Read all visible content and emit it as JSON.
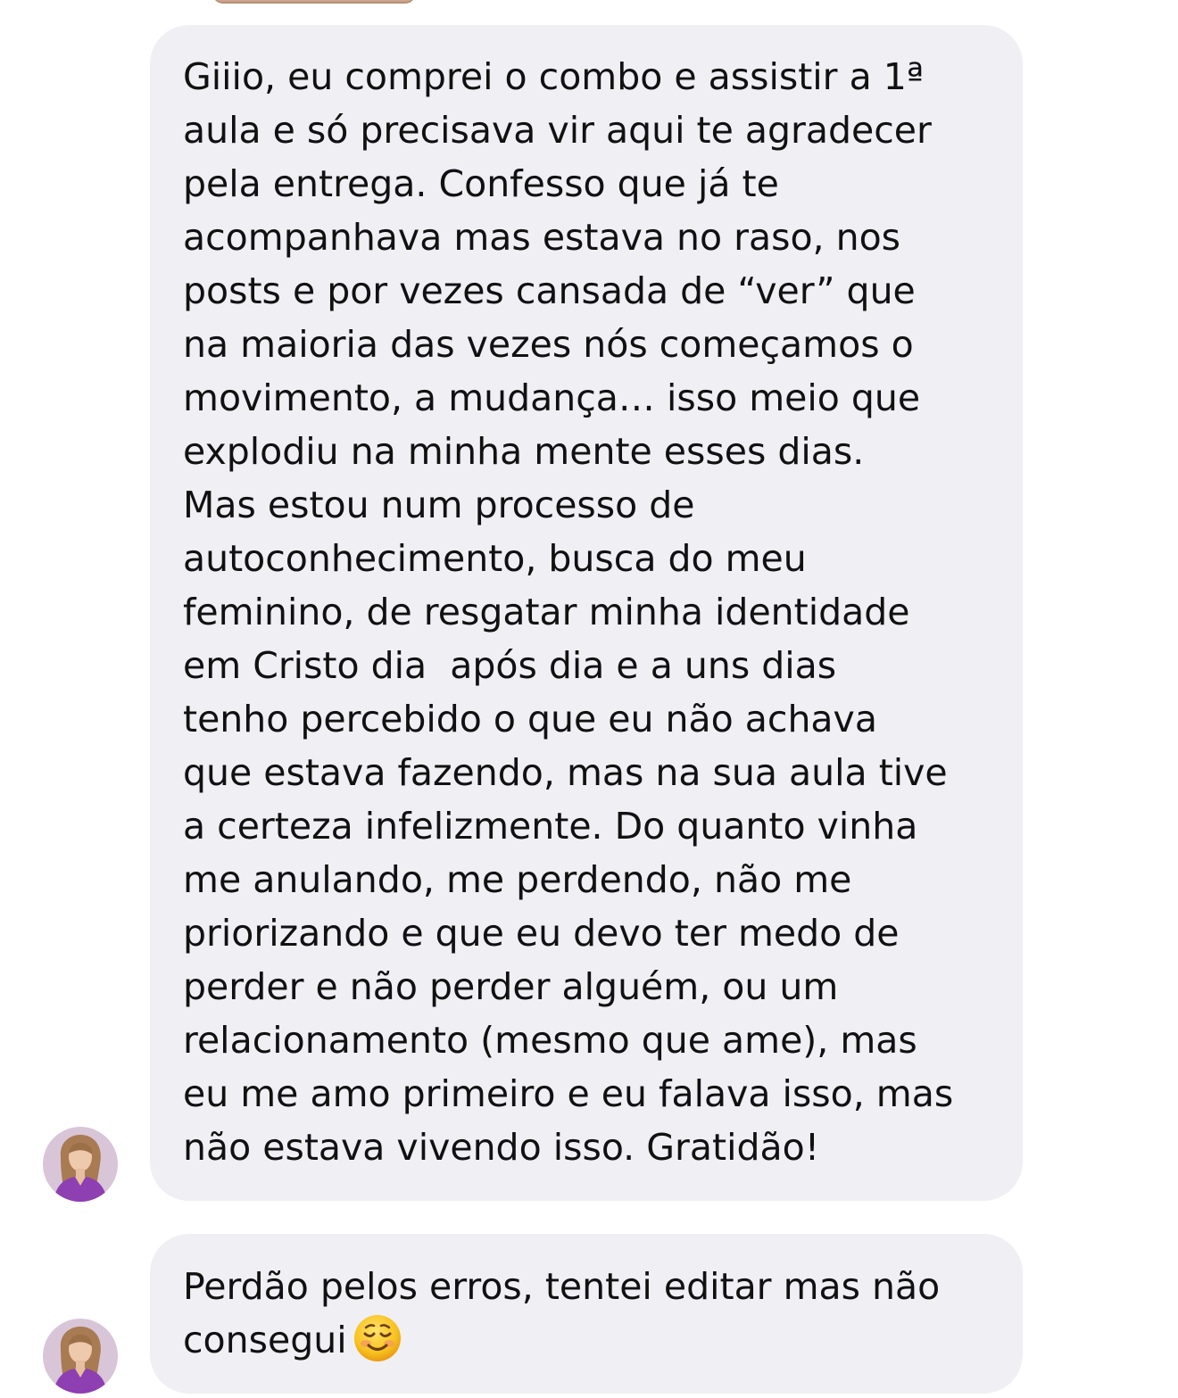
{
  "chat": {
    "previous_fragment": "media-thumbnail",
    "messages": [
      {
        "sender_avatar": "person-avatar",
        "lines": [
          "Giiio, eu comprei o combo e assistir a 1ª",
          "aula e só precisava vir aqui te agradecer",
          "pela entrega. Confesso que já te",
          "acompanhava mas estava no raso, nos",
          "posts e por vezes cansada de “ver” que",
          "na maioria das vezes nós começamos o",
          "movimento, a mudança… isso meio que",
          "explodiu na minha mente esses dias.",
          "Mas estou num processo de",
          "autoconhecimento, busca do meu",
          "feminino, de resgatar minha identidade",
          "em Cristo dia  após dia e a uns dias",
          "tenho percebido o que eu não achava",
          "que estava fazendo, mas na sua aula tive",
          "a certeza infelizmente. Do quanto vinha",
          "me anulando, me perdendo, não me",
          "priorizando e que eu devo ter medo de",
          "perder e não perder alguém, ou um",
          "relacionamento (mesmo que ame), mas",
          "eu me amo primeiro e eu falava isso, mas",
          "não estava vivendo isso. Gratidão!"
        ]
      },
      {
        "sender_avatar": "person-avatar",
        "lines": [
          "Perdão pelos erros, tentei editar mas não",
          "consegui"
        ],
        "emoji": "smiling-face-emoji"
      }
    ]
  },
  "colors": {
    "bubble_bg": "#efeff4",
    "text": "#111111",
    "avatar_shirt": "#8e3fb1",
    "avatar_bg": "#d8c6d8"
  }
}
